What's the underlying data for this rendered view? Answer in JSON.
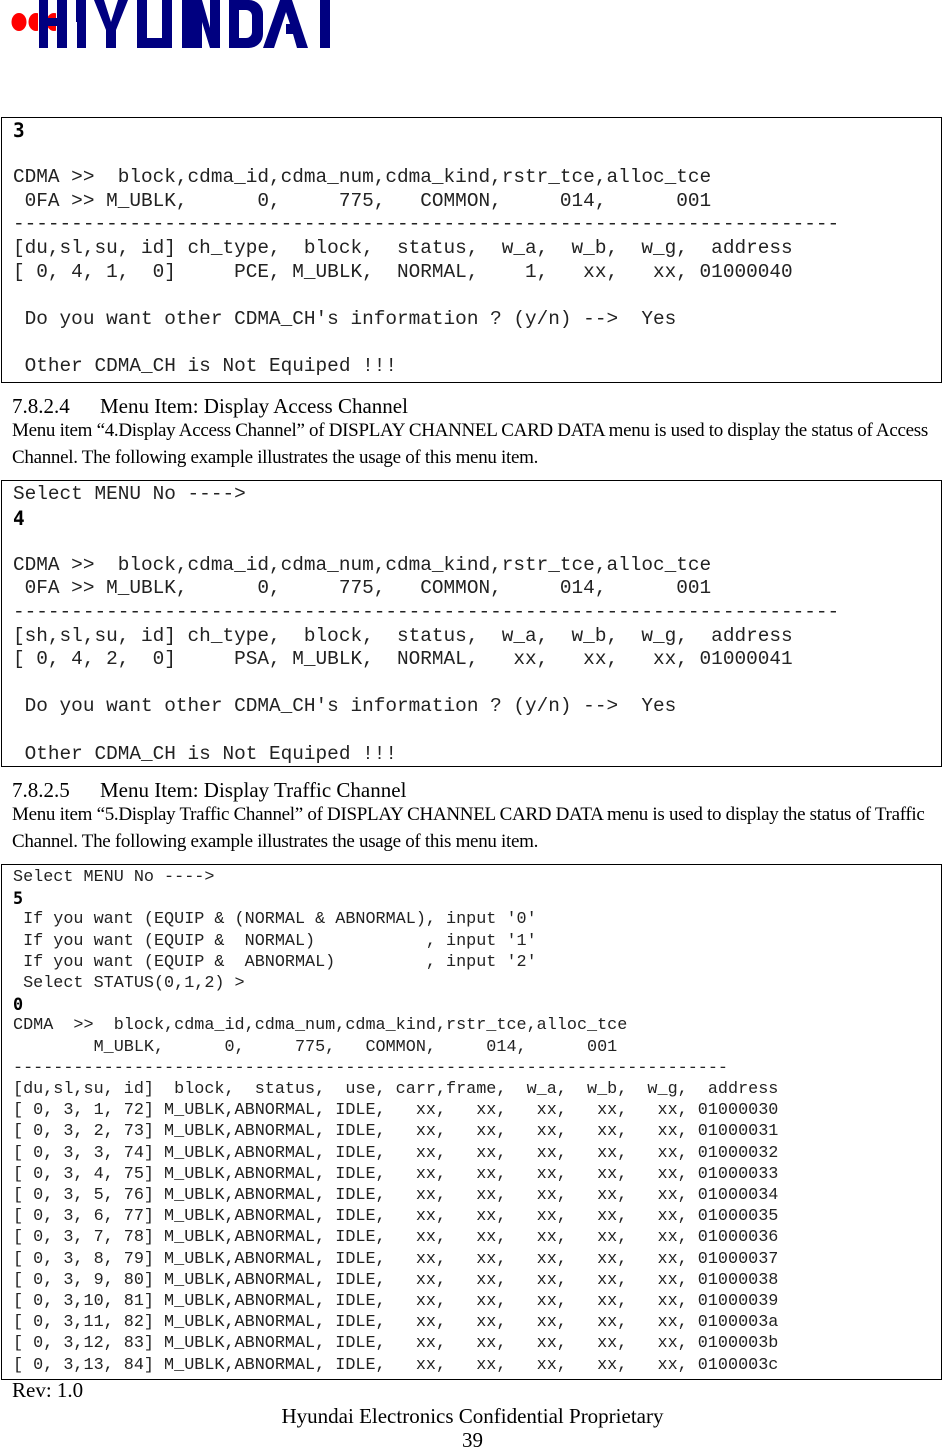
{
  "header": {
    "logo_text": "HYUNDAI",
    "brand_colors": {
      "primary": "#000080",
      "accent": "#ff0000"
    }
  },
  "box1": {
    "lines": [
      {
        "text": "3",
        "bold": true
      },
      {
        "text": ""
      },
      {
        "text": "CDMA >>  block,cdma_id,cdma_num,cdma_kind,rstr_tce,alloc_tce"
      },
      {
        "text": " 0FA >> M_UBLK,      0,     775,   COMMON,     014,      001"
      },
      {
        "text": "-----------------------------------------------------------------------"
      },
      {
        "text": "[du,sl,su, id] ch_type,  block,  status,  w_a,  w_b,  w_g,  address"
      },
      {
        "text": "[ 0, 4, 1,  0]     PCE, M_UBLK,  NORMAL,    1,   xx,   xx, 01000040"
      },
      {
        "text": ""
      },
      {
        "text": " Do you want other CDMA_CH's information ? (y/n) -->  Yes"
      },
      {
        "text": ""
      },
      {
        "text": " Other CDMA_CH is Not Equiped !!!"
      }
    ]
  },
  "section1": {
    "number": "7.8.2.4",
    "title": "Menu Item: Display Access Channel",
    "paragraph": "Menu item “4.Display Access Channel” of DISPLAY CHANNEL CARD DATA menu is used to display the status of Access Channel. The following example illustrates the usage of this menu item."
  },
  "box2": {
    "lines": [
      {
        "text": "Select MENU No ---->"
      },
      {
        "text": "4",
        "bold": true
      },
      {
        "text": ""
      },
      {
        "text": "CDMA >>  block,cdma_id,cdma_num,cdma_kind,rstr_tce,alloc_tce"
      },
      {
        "text": " 0FA >> M_UBLK,      0,     775,   COMMON,     014,      001"
      },
      {
        "text": "-----------------------------------------------------------------------"
      },
      {
        "text": "[sh,sl,su, id] ch_type,  block,  status,  w_a,  w_b,  w_g,  address"
      },
      {
        "text": "[ 0, 4, 2,  0]     PSA, M_UBLK,  NORMAL,   xx,   xx,   xx, 01000041"
      },
      {
        "text": ""
      },
      {
        "text": " Do you want other CDMA_CH's information ? (y/n) -->  Yes"
      },
      {
        "text": ""
      },
      {
        "text": " Other CDMA_CH is Not Equiped !!!"
      }
    ]
  },
  "section2": {
    "number": "7.8.2.5",
    "title": "Menu Item: Display Traffic Channel",
    "paragraph": "Menu item “5.Display Traffic Channel” of DISPLAY CHANNEL CARD DATA menu is used to display the status of Traffic Channel. The following example illustrates the usage of this menu item."
  },
  "box3": {
    "lines": [
      {
        "text": "Select MENU No ---->"
      },
      {
        "text": "5",
        "bold": true
      },
      {
        "text": " If you want (EQUIP & (NORMAL & ABNORMAL), input '0'"
      },
      {
        "text": " If you want (EQUIP &  NORMAL)           , input '1'"
      },
      {
        "text": " If you want (EQUIP &  ABNORMAL)         , input '2'"
      },
      {
        "text": " Select STATUS(0,1,2) >"
      },
      {
        "text": "0",
        "bold": true
      },
      {
        "text": "CDMA  >>  block,cdma_id,cdma_num,cdma_kind,rstr_tce,alloc_tce"
      },
      {
        "text": "        M_UBLK,      0,     775,   COMMON,     014,      001"
      },
      {
        "text": "-----------------------------------------------------------------------"
      },
      {
        "text": "[du,sl,su, id]  block,  status,  use, carr,frame,  w_a,  w_b,  w_g,  address"
      },
      {
        "text": "[ 0, 3, 1, 72] M_UBLK,ABNORMAL, IDLE,   xx,   xx,   xx,   xx,   xx, 01000030"
      },
      {
        "text": "[ 0, 3, 2, 73] M_UBLK,ABNORMAL, IDLE,   xx,   xx,   xx,   xx,   xx, 01000031"
      },
      {
        "text": "[ 0, 3, 3, 74] M_UBLK,ABNORMAL, IDLE,   xx,   xx,   xx,   xx,   xx, 01000032"
      },
      {
        "text": "[ 0, 3, 4, 75] M_UBLK,ABNORMAL, IDLE,   xx,   xx,   xx,   xx,   xx, 01000033"
      },
      {
        "text": "[ 0, 3, 5, 76] M_UBLK,ABNORMAL, IDLE,   xx,   xx,   xx,   xx,   xx, 01000034"
      },
      {
        "text": "[ 0, 3, 6, 77] M_UBLK,ABNORMAL, IDLE,   xx,   xx,   xx,   xx,   xx, 01000035"
      },
      {
        "text": "[ 0, 3, 7, 78] M_UBLK,ABNORMAL, IDLE,   xx,   xx,   xx,   xx,   xx, 01000036"
      },
      {
        "text": "[ 0, 3, 8, 79] M_UBLK,ABNORMAL, IDLE,   xx,   xx,   xx,   xx,   xx, 01000037"
      },
      {
        "text": "[ 0, 3, 9, 80] M_UBLK,ABNORMAL, IDLE,   xx,   xx,   xx,   xx,   xx, 01000038"
      },
      {
        "text": "[ 0, 3,10, 81] M_UBLK,ABNORMAL, IDLE,   xx,   xx,   xx,   xx,   xx, 01000039"
      },
      {
        "text": "[ 0, 3,11, 82] M_UBLK,ABNORMAL, IDLE,   xx,   xx,   xx,   xx,   xx, 0100003a"
      },
      {
        "text": "[ 0, 3,12, 83] M_UBLK,ABNORMAL, IDLE,   xx,   xx,   xx,   xx,   xx, 0100003b"
      },
      {
        "text": "[ 0, 3,13, 84] M_UBLK,ABNORMAL, IDLE,   xx,   xx,   xx,   xx,   xx, 0100003c"
      }
    ]
  },
  "footer": {
    "revision": "Rev: 1.0",
    "confidential": "Hyundai Electronics Confidential Proprietary",
    "page_number": "39"
  }
}
